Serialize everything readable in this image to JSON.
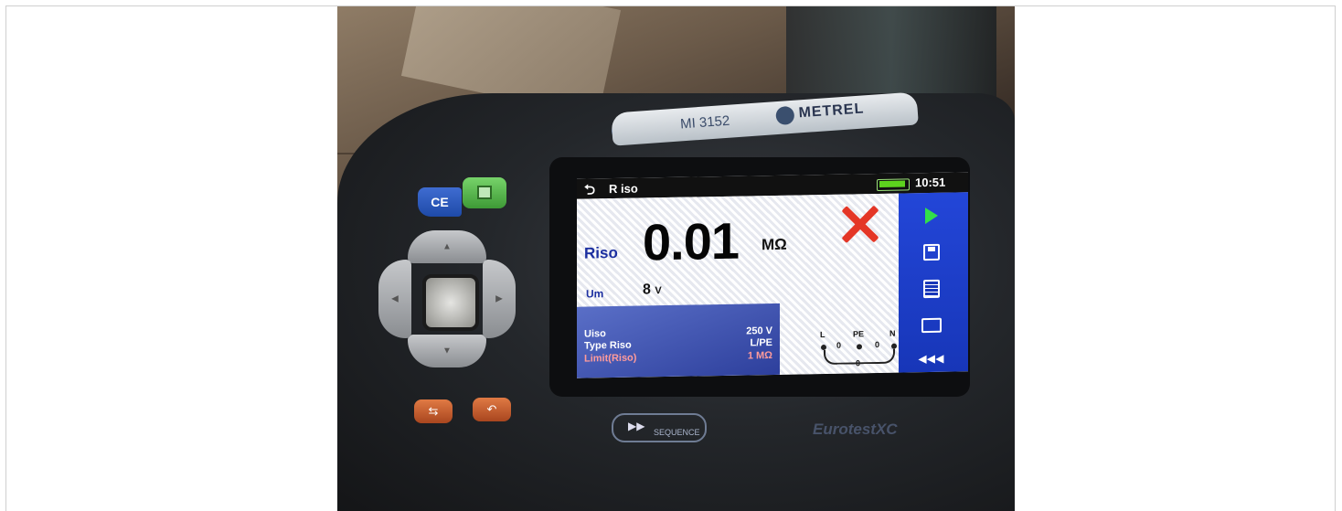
{
  "device": {
    "model": "MI 3152",
    "brand": "METREL",
    "product_name": "EurotestXC",
    "sequence_label": "SEQUENCE",
    "ce_mark": "CE"
  },
  "screen": {
    "status_bar": {
      "title": "R iso",
      "time": "10:51",
      "battery_level": 1.0
    },
    "result": {
      "label": "Riso",
      "value": "0.01",
      "unit": "MΩ",
      "status": "fail"
    },
    "measurement": {
      "label": "Um",
      "value": "8",
      "unit": "V"
    },
    "parameters": [
      {
        "label": "Uiso",
        "value": "250 V"
      },
      {
        "label": "Type Riso",
        "value": "L/PE"
      },
      {
        "label": "Limit(Riso)",
        "value": "1 MΩ"
      }
    ],
    "terminals": {
      "letters": [
        "L",
        "PE",
        "N"
      ],
      "values": [
        "0",
        "0",
        "0",
        "0"
      ]
    },
    "side_menu": [
      "play-icon",
      "save-icon",
      "list-icon",
      "comment-icon",
      "more-icon"
    ]
  },
  "colors": {
    "screen_blue": "#1736b8",
    "fail_red": "#e43626",
    "label_blue": "#1c2fa0",
    "save_green": "#3e9a36"
  }
}
